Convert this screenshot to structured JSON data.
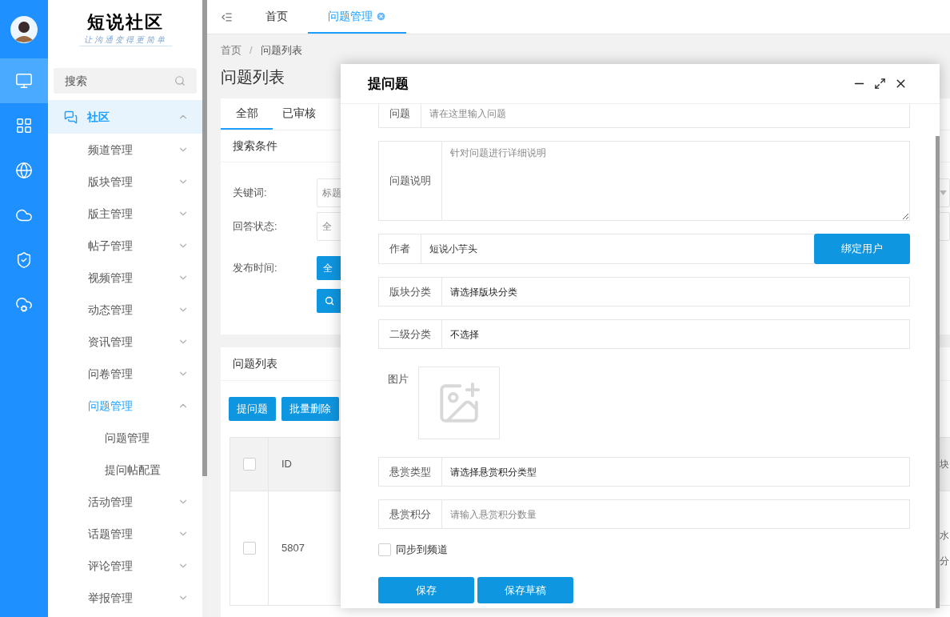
{
  "rail": {
    "items": [
      {
        "kind": "monitor",
        "selected": true
      },
      {
        "kind": "grid",
        "selected": false
      },
      {
        "kind": "globe",
        "selected": false
      },
      {
        "kind": "cloud",
        "selected": false
      },
      {
        "kind": "shield",
        "selected": false
      },
      {
        "kind": "cloud_gear",
        "selected": false
      }
    ]
  },
  "logo": {
    "title": "短说社区",
    "slogan": "让沟通变得更简单"
  },
  "sidebar": {
    "search": {
      "placeholder": "搜索"
    },
    "group": {
      "label": "社区",
      "expanded": true,
      "selected": true
    },
    "items": [
      {
        "label": "频道管理",
        "expanded": false,
        "selected": false
      },
      {
        "label": "版块管理",
        "expanded": false,
        "selected": false
      },
      {
        "label": "版主管理",
        "expanded": false,
        "selected": false
      },
      {
        "label": "帖子管理",
        "expanded": false,
        "selected": false
      },
      {
        "label": "视频管理",
        "expanded": false,
        "selected": false
      },
      {
        "label": "动态管理",
        "expanded": false,
        "selected": false
      },
      {
        "label": "资讯管理",
        "expanded": false,
        "selected": false
      },
      {
        "label": "问卷管理",
        "expanded": false,
        "selected": false
      },
      {
        "label": "问题管理",
        "expanded": true,
        "selected": true,
        "children": [
          {
            "label": "问题管理",
            "selected": false
          },
          {
            "label": "提问帖配置",
            "selected": false
          }
        ]
      },
      {
        "label": "活动管理",
        "expanded": false,
        "selected": false
      },
      {
        "label": "话题管理",
        "expanded": false,
        "selected": false
      },
      {
        "label": "评论管理",
        "expanded": false,
        "selected": false
      },
      {
        "label": "举报管理",
        "expanded": false,
        "selected": false
      }
    ]
  },
  "tabs": [
    {
      "label": "首页",
      "selected": false,
      "closable": false
    },
    {
      "label": "问题管理",
      "selected": true,
      "closable": true
    }
  ],
  "breadcrumb": {
    "items": [
      "首页",
      "问题列表"
    ],
    "separator": "/"
  },
  "page_title": "问题列表",
  "filter_card": {
    "tabs": [
      {
        "label": "全部",
        "selected": true
      },
      {
        "label": "已审核",
        "selected": false
      }
    ],
    "title": "搜索条件",
    "fields": [
      {
        "kind": "input",
        "label": "关键词:",
        "placeholder": "标题"
      },
      {
        "kind": "input",
        "label": "回答状态:",
        "placeholder": "全"
      },
      {
        "kind": "button",
        "label": "发布时间:",
        "value": "全"
      }
    ]
  },
  "list_card": {
    "title": "问题列表",
    "buttons": [
      "提问题",
      "批量删除"
    ],
    "table": {
      "select_all": {
        "checked": false
      },
      "columns": [
        "ID",
        "块"
      ],
      "rows": [
        {
          "checked": false,
          "cells": [
            "5807",
            [
              "水",
              "分"
            ]
          ]
        }
      ]
    }
  },
  "dialog": {
    "title": "提问题",
    "fields": [
      {
        "kind": "input",
        "label": "问题",
        "placeholder": "请在这里输入问题"
      },
      {
        "kind": "textarea",
        "label": "问题说明",
        "placeholder": "针对问题进行详细说明"
      },
      {
        "kind": "input_button",
        "label": "作者",
        "value": "短说小芋头",
        "button": "绑定用户"
      },
      {
        "kind": "select",
        "label": "版块分类",
        "value": "请选择版块分类"
      },
      {
        "kind": "select",
        "label": "二级分类",
        "value": "不选择"
      },
      {
        "kind": "image",
        "label": "图片"
      },
      {
        "kind": "select",
        "label": "悬赏类型",
        "value": "请选择悬赏积分类型"
      },
      {
        "kind": "input",
        "label": "悬赏积分",
        "placeholder": "请输入悬赏积分数量"
      },
      {
        "kind": "checkbox",
        "label": "同步到频道",
        "checked": false
      }
    ],
    "buttons": [
      "保存",
      "保存草稿"
    ]
  }
}
